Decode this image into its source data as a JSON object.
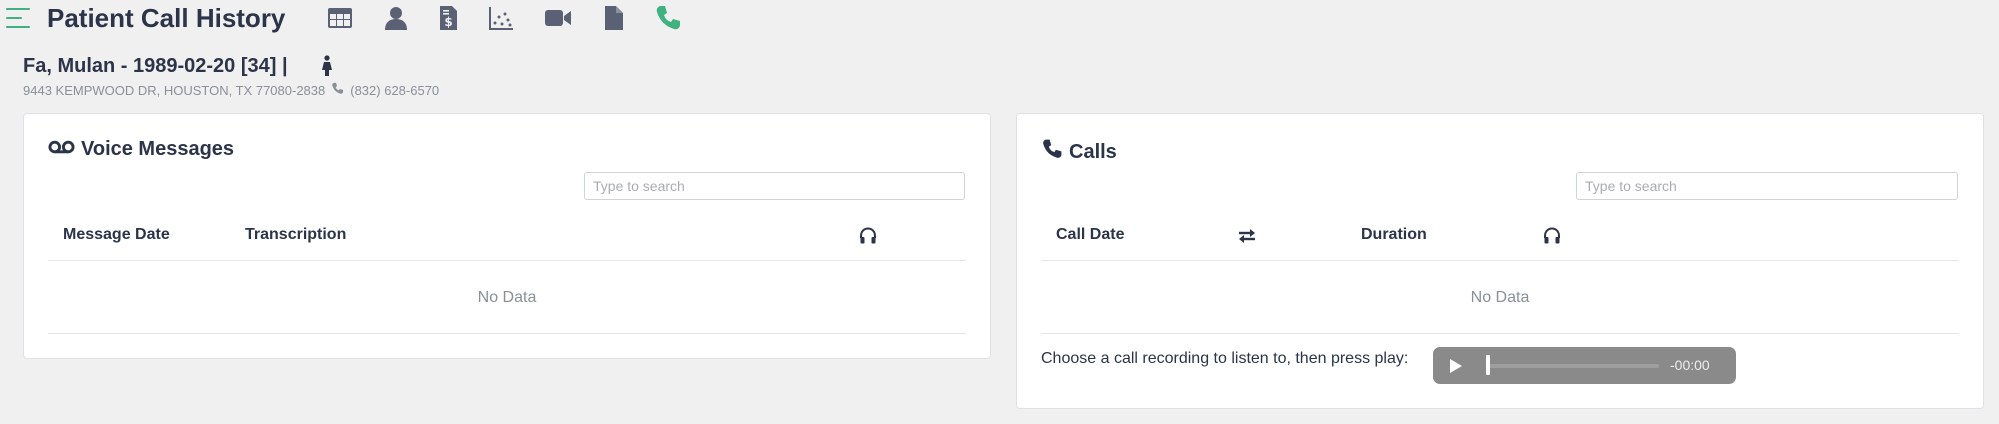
{
  "header": {
    "title": "Patient Call History",
    "nav_icons": [
      "table-icon",
      "user-icon",
      "billing-icon",
      "scatter-chart-icon",
      "video-icon",
      "document-icon",
      "phone-icon"
    ],
    "active_icon": "phone-icon"
  },
  "patient": {
    "name_line": "Fa, Mulan - 1989-02-20 [34] |",
    "sex_icon": "female-icon",
    "address": "9443 KEMPWOOD DR, HOUSTON, TX 77080-2838",
    "phone": "(832) 628-6570"
  },
  "voice_messages": {
    "title": "Voice Messages",
    "search_placeholder": "Type to search",
    "columns": [
      "Message Date",
      "Transcription"
    ],
    "listen_icon": "headphones-icon",
    "empty_text": "No Data"
  },
  "calls": {
    "title": "Calls",
    "search_placeholder": "Type to search",
    "columns": [
      "Call Date",
      "Duration"
    ],
    "direction_icon": "swap-arrows-icon",
    "listen_icon": "headphones-icon",
    "empty_text": "No Data",
    "player_prompt": "Choose a call recording to listen to, then press play:",
    "player_time": "-00:00",
    "player_progress": 0
  },
  "colors": {
    "accent": "#3fb27f",
    "heading": "#2b3449",
    "icon": "#5b6174",
    "background": "#f0f0f0",
    "player": "#8a8a8a"
  }
}
